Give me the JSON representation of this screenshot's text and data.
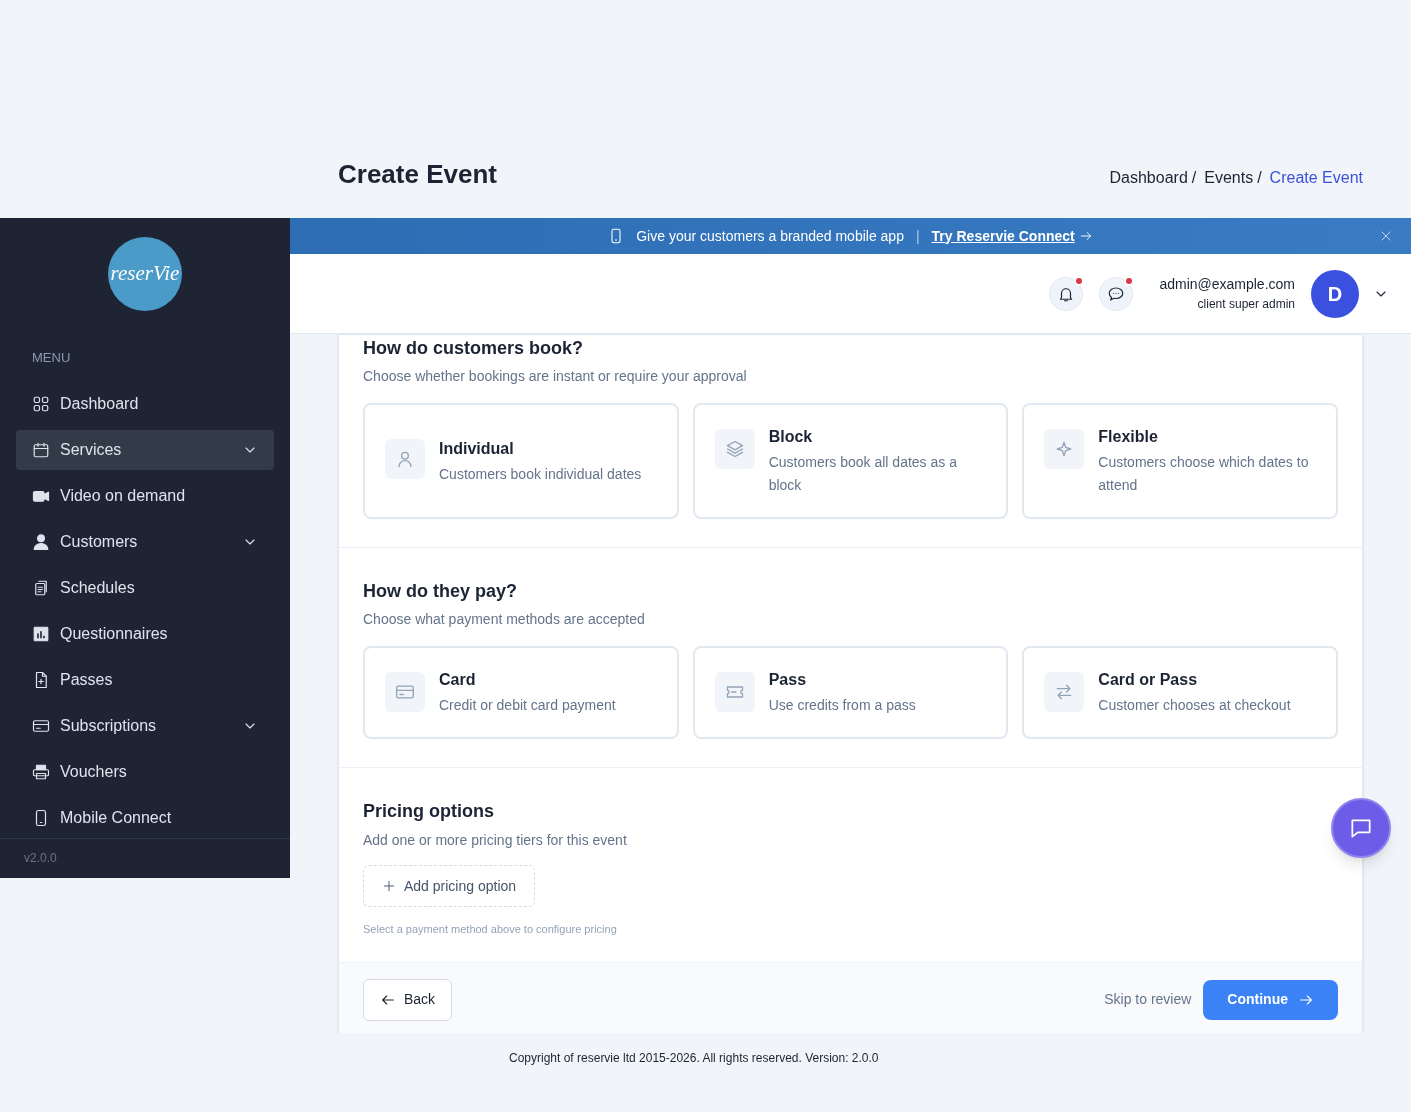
{
  "page_title": "Create Event",
  "breadcrumb_separator": "/",
  "breadcrumb": [
    {
      "label": "Dashboard",
      "current": false
    },
    {
      "label": "Events",
      "current": false
    },
    {
      "label": "Create Event",
      "current": true
    }
  ],
  "sidebar": {
    "logo_text": "reserVie",
    "menu_label": "MENU",
    "version": "v2.0.0",
    "items": [
      {
        "label": "Dashboard",
        "selected": false
      },
      {
        "label": "Services",
        "selected": true,
        "expanded": false
      },
      {
        "label": "Video on demand",
        "selected": false
      },
      {
        "label": "Customers",
        "selected": false,
        "expanded": false
      },
      {
        "label": "Schedules",
        "selected": false
      },
      {
        "label": "Questionnaires",
        "selected": false
      },
      {
        "label": "Passes",
        "selected": false
      },
      {
        "label": "Subscriptions",
        "selected": false,
        "expanded": false
      },
      {
        "label": "Vouchers",
        "selected": false
      },
      {
        "label": "Mobile Connect",
        "selected": false
      }
    ]
  },
  "banner": {
    "text": "Give your customers a branded mobile app",
    "separator": "|",
    "link": "Try Reservie Connect"
  },
  "topbar": {
    "notifications_unread": true,
    "messages_unread": true,
    "email": "admin@example.com",
    "role": "client super admin",
    "avatar_letter": "D"
  },
  "sections": [
    {
      "title": "How do customers book?",
      "subtitle": "Choose whether bookings are instant or require your approval",
      "options": [
        {
          "title": "Individual",
          "description": "Customers book individual dates",
          "selected": false
        },
        {
          "title": "Block",
          "description": "Customers book all dates as a block",
          "selected": false
        },
        {
          "title": "Flexible",
          "description": "Customers choose which dates to attend",
          "selected": false
        }
      ]
    },
    {
      "title": "How do they pay?",
      "subtitle": "Choose what payment methods are accepted",
      "options": [
        {
          "title": "Card",
          "description": "Credit or debit card payment",
          "selected": false
        },
        {
          "title": "Pass",
          "description": "Use credits from a pass",
          "selected": false
        },
        {
          "title": "Card or Pass",
          "description": "Customer chooses at checkout",
          "selected": false
        }
      ]
    }
  ],
  "pricing": {
    "title": "Pricing options",
    "subtitle": "Add one or more pricing tiers for this event",
    "add_button": "Add pricing option",
    "hint": "Select a payment method above to configure pricing"
  },
  "footer_actions": {
    "back": "Back",
    "skip": "Skip to review",
    "continue": "Continue"
  },
  "copyright": "Copyright of reservie ltd 2015-2026. All rights reserved. Version: 2.0.0"
}
